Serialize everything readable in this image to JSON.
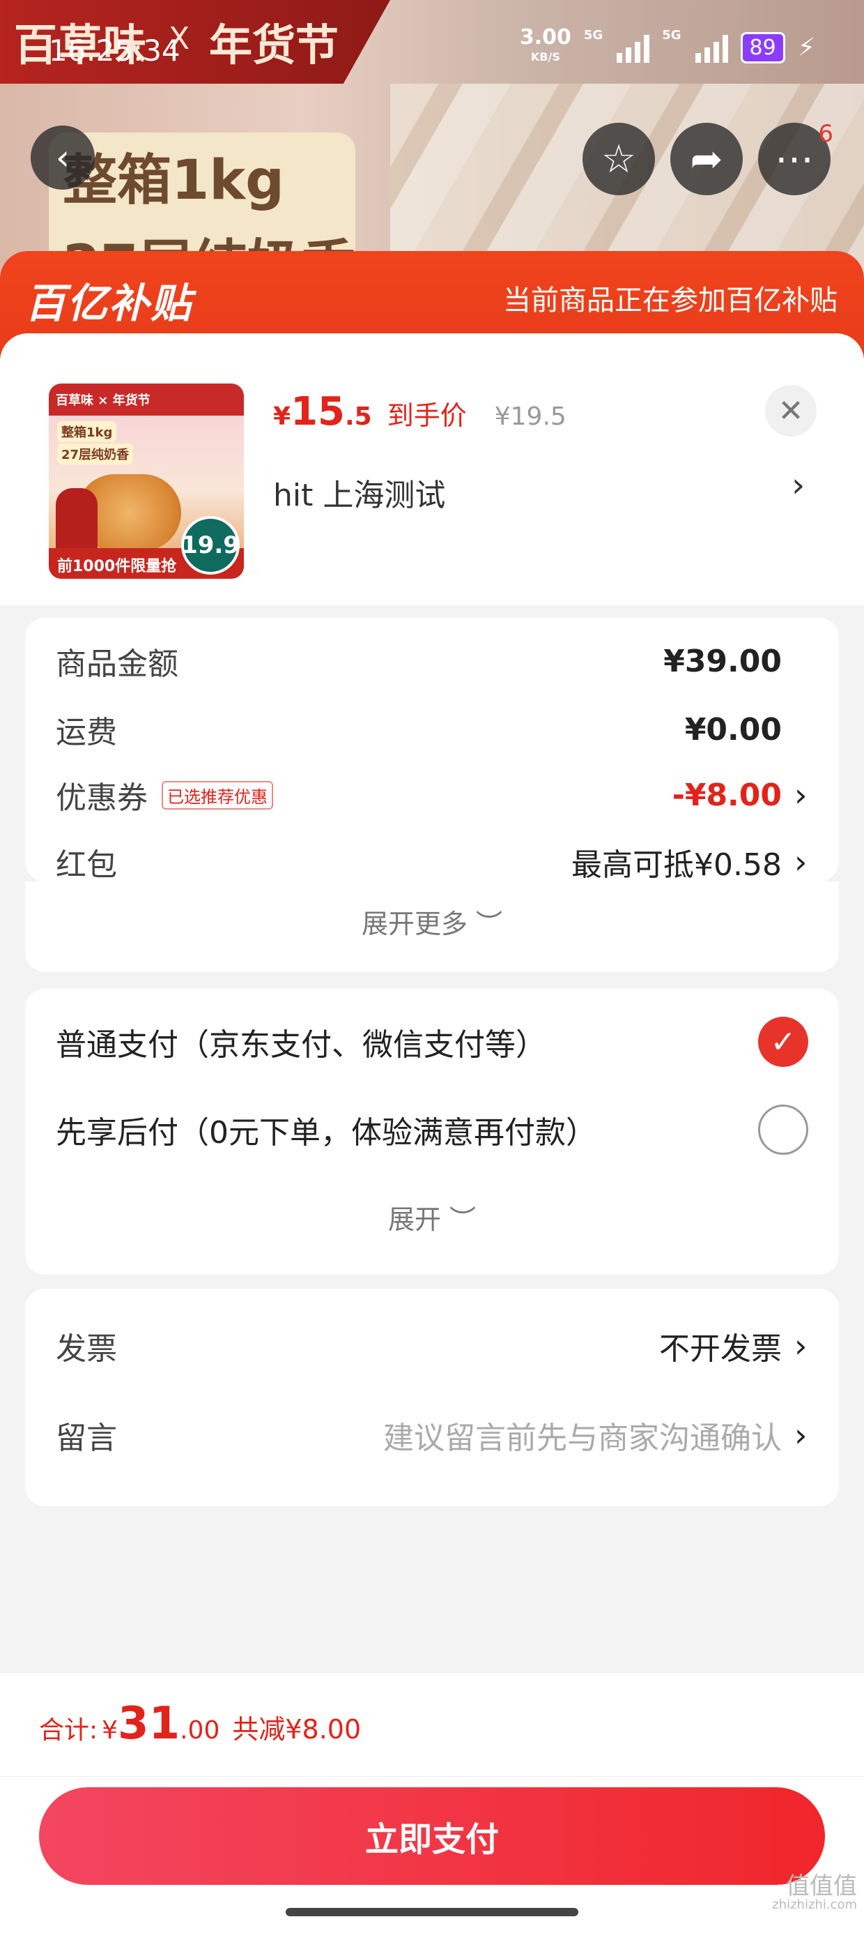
{
  "status_bar": {
    "time": "16:25:34",
    "speed_value": "3.00",
    "speed_unit": "KB/S",
    "network_1": "5G",
    "network_2": "5G",
    "battery": "89"
  },
  "banner": {
    "brand": "百草味",
    "brand_x": "X",
    "brand_event": "年货节",
    "feature_1": "整箱1kg",
    "feature_2": "27层纯奶香",
    "more_badge": "6"
  },
  "subsidy": {
    "logo": "百亿补贴",
    "message": "当前商品正在参加百亿补贴"
  },
  "product": {
    "thumb_brand": "百草味 × 年货节",
    "thumb_tag_1": "整箱1kg",
    "thumb_tag_2": "27层纯奶香",
    "thumb_bottom": "前1000件限量抢",
    "thumb_price": "19.9",
    "price_currency": "¥",
    "price_integer": "15",
    "price_decimal": ".5",
    "price_label": "到手价",
    "original_price": "¥19.5",
    "address": "hit  上海测试"
  },
  "fees": {
    "goods_label": "商品金额",
    "goods_value": "¥39.00",
    "shipping_label": "运费",
    "shipping_value": "¥0.00",
    "coupon_label": "优惠券",
    "coupon_tag": "已选推荐优惠",
    "coupon_value": "-¥8.00",
    "redpacket_label": "红包",
    "redpacket_value": "最高可抵¥0.58",
    "expand_more": "展开更多 ︶"
  },
  "payment": {
    "option_1": "普通支付（京东支付、微信支付等）",
    "option_2": "先享后付（0元下单，体验满意再付款）",
    "expand": "展开 ︶",
    "selected": 1
  },
  "extras": {
    "invoice_label": "发票",
    "invoice_value": "不开发票",
    "note_label": "留言",
    "note_placeholder": "建议留言前先与商家沟通确认"
  },
  "footer": {
    "total_label": "合计:",
    "total_currency": "¥",
    "total_integer": "31",
    "total_decimal": ".00",
    "total_saving": "共减¥8.00",
    "pay_button": "立即支付"
  },
  "watermark": {
    "main": "值值值",
    "sub": "zhizhizhi.com"
  },
  "colors": {
    "accent_red": "#e2231a",
    "subsidy_orange": "#f0441d",
    "pay_button": "#f0262b"
  }
}
